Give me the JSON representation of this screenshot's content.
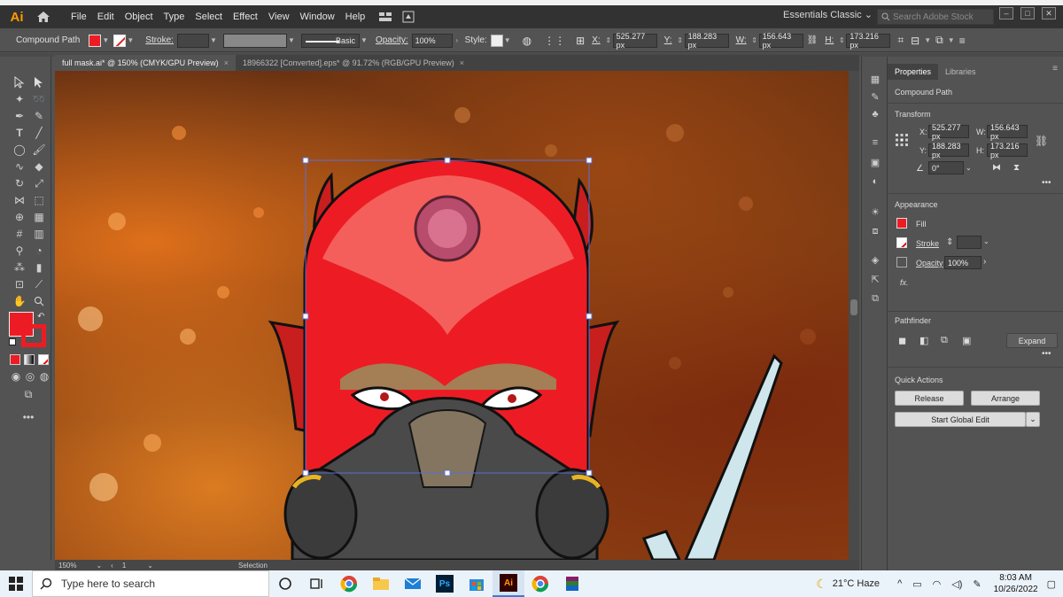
{
  "menubar": {
    "logo": "Ai",
    "items": [
      "File",
      "Edit",
      "Object",
      "Type",
      "Select",
      "Effect",
      "View",
      "Window",
      "Help"
    ],
    "workspace": "Essentials Classic",
    "search_placeholder": "Search Adobe Stock"
  },
  "control_bar": {
    "object_type": "Compound Path",
    "stroke_label": "Stroke:",
    "brush_label": "Basic",
    "opacity_label": "Opacity:",
    "opacity_value": "100%",
    "style_label": "Style:",
    "x_label": "X:",
    "x_value": "525.277 px",
    "y_label": "Y:",
    "y_value": "188.283 px",
    "w_label": "W:",
    "w_value": "156.643 px",
    "h_label": "H:",
    "h_value": "173.216 px"
  },
  "tabs": [
    {
      "label": "full mask.ai* @ 150% (CMYK/GPU Preview)",
      "close": "×"
    },
    {
      "label": "18966322 [Converted].eps* @ 91.72% (RGB/GPU Preview)",
      "close": "×"
    }
  ],
  "status_bar": {
    "zoom": "150%",
    "artboard": "1",
    "tool": "Selection"
  },
  "properties": {
    "tabs": [
      "Properties",
      "Libraries"
    ],
    "selection_type": "Compound Path",
    "transform_title": "Transform",
    "x_label": "X:",
    "x_value": "525.277 px",
    "y_label": "Y:",
    "y_value": "188.283 px",
    "w_label": "W:",
    "w_value": "156.643 px",
    "h_label": "H:",
    "h_value": "173.216 px",
    "angle_value": "0°",
    "appearance_title": "Appearance",
    "fill_label": "Fill",
    "stroke_label": "Stroke",
    "opacity_label": "Opacity",
    "opacity_value": "100%",
    "fx_label": "fx.",
    "pathfinder_title": "Pathfinder",
    "expand_label": "Expand",
    "quick_actions_title": "Quick Actions",
    "release_label": "Release",
    "arrange_label": "Arrange",
    "global_edit_label": "Start Global Edit"
  },
  "taskbar": {
    "search_placeholder": "Type here to search",
    "weather": "21°C  Haze",
    "time": "8:03 AM",
    "date": "10/26/2022"
  },
  "colors": {
    "fill": "#ed1c24",
    "app_bg": "#535353",
    "menubar_bg": "#323232",
    "ai_orange": "#ff9a00"
  }
}
